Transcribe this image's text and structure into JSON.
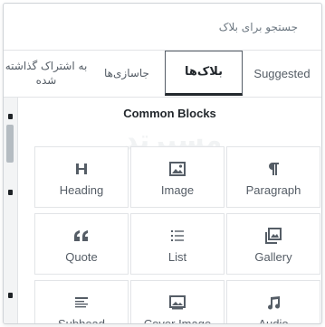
{
  "search": {
    "placeholder": "جستجو برای بلاک"
  },
  "tabs": [
    {
      "label": "به اشتراک گذاشته شده"
    },
    {
      "label": "جاسازی‌ها"
    },
    {
      "label": "بلاک‌ها",
      "active": true
    },
    {
      "label": "Suggested"
    }
  ],
  "section": {
    "title": "Common Blocks"
  },
  "watermark": "مسیرتد",
  "blocks": [
    {
      "label": "Heading",
      "icon": "heading-icon"
    },
    {
      "label": "Image",
      "icon": "image-icon"
    },
    {
      "label": "Paragraph",
      "icon": "paragraph-icon"
    },
    {
      "label": "Quote",
      "icon": "quote-icon"
    },
    {
      "label": "List",
      "icon": "list-icon"
    },
    {
      "label": "Gallery",
      "icon": "gallery-icon"
    },
    {
      "label": "Subhead",
      "icon": "subhead-icon"
    },
    {
      "label": "Cover Image",
      "icon": "cover-image-icon"
    },
    {
      "label": "Audio",
      "icon": "audio-icon"
    }
  ]
}
